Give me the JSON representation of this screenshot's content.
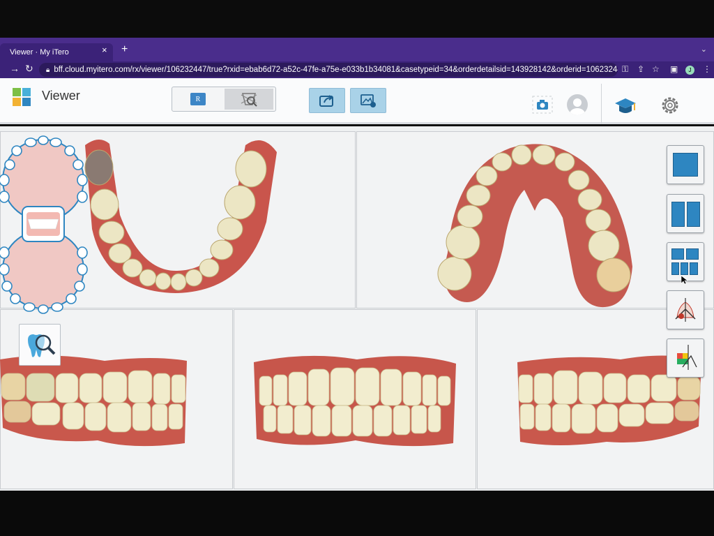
{
  "browser": {
    "tab_title": "Viewer · My iTero",
    "tab_close": "×",
    "new_tab": "+",
    "url": "bff.cloud.myitero.com/rx/viewer/106232447/true?rxid=ebab6d72-a52c-47fe-a75e-e033b1b34081&casetypeid=34&orderdetailsid=143928142&orderid=10623244…",
    "profile_initial": "J",
    "icons": [
      "back-arrow-icon",
      "forward-arrow-icon",
      "reload-icon",
      "lock-icon",
      "key-icon",
      "share-icon",
      "bookmark-star-icon",
      "sidebar-icon",
      "menu-dots-icon"
    ]
  },
  "app": {
    "title": "Viewer",
    "rx_label": "R",
    "accent": "#2e86c1",
    "logo_colors": [
      "#2e86c1",
      "#7dbf45",
      "#f2b233",
      "#48b0d9"
    ]
  },
  "layout_tools": [
    {
      "name": "layout-single-button",
      "icon": "single-view-icon"
    },
    {
      "name": "layout-double-button",
      "icon": "two-view-icon"
    },
    {
      "name": "layout-five-button",
      "icon": "five-view-icon"
    },
    {
      "name": "margin-line-button",
      "icon": "margin-line-icon"
    },
    {
      "name": "clearance-map-button",
      "icon": "clearance-map-icon"
    }
  ]
}
